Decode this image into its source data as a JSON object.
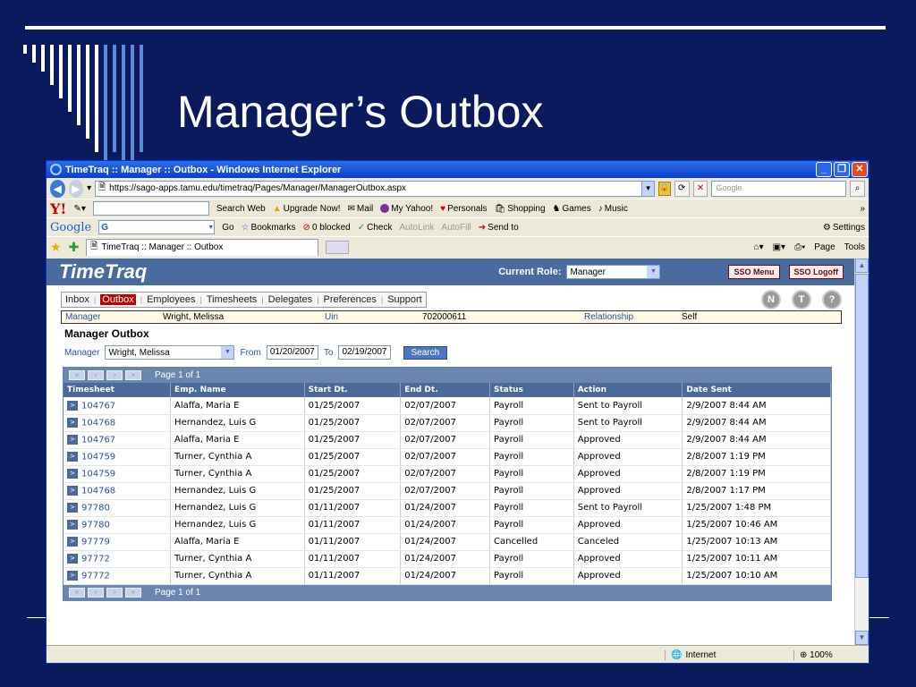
{
  "slide": {
    "title": "Manager’s Outbox"
  },
  "browser": {
    "window_title": "TimeTraq :: Manager :: Outbox - Windows Internet Explorer",
    "window_buttons": [
      "_",
      "❐",
      "✕"
    ],
    "address": "https://sago-apps.tamu.edu/timetraq/Pages/Manager/ManagerOutbox.aspx",
    "search_placeholder": "Google",
    "yahoo_toolbar": {
      "logo": "Y!",
      "search_button": "Search Web",
      "items": [
        "Upgrade Now!",
        "Mail",
        "My Yahoo!",
        "Personals",
        "Shopping",
        "Games",
        "Music"
      ]
    },
    "google_toolbar": {
      "logo": "Google",
      "g_label": "G",
      "go": "Go",
      "items": [
        "Bookmarks",
        "0 blocked",
        "Check",
        "AutoLink",
        "AutoFill",
        "Send to"
      ],
      "settings": "Settings"
    },
    "tab_title": "TimeTraq :: Manager :: Outbox",
    "tab_tools": [
      "Page",
      "Tools"
    ],
    "status": {
      "zone": "Internet",
      "zoom": "100%"
    }
  },
  "app": {
    "logo": "TimeTraq",
    "role_label": "Current Role:",
    "role_value": "Manager",
    "sso_menu": "SSO Menu",
    "sso_logoff": "SSO Logoff",
    "nav": [
      "Inbox",
      "Outbox",
      "Employees",
      "Timesheets",
      "Delegates",
      "Preferences",
      "Support"
    ],
    "nav_active_index": 1,
    "circle_buttons": [
      "N",
      "T",
      "?"
    ],
    "info": {
      "role": "Manager",
      "name": "Wright, Melissa",
      "uin_label": "Uin",
      "uin": "702000611",
      "relationship_label": "Relationship",
      "relationship": "Self"
    },
    "section_title": "Manager Outbox",
    "filter": {
      "manager_label": "Manager",
      "manager_value": "Wright, Melissa",
      "from_label": "From",
      "from_value": "01/20/2007",
      "to_label": "To",
      "to_value": "02/19/2007",
      "search_button": "Search"
    },
    "pager_text": "Page 1 of 1",
    "columns": [
      "Timesheet",
      "Emp. Name",
      "Start Dt.",
      "End Dt.",
      "Status",
      "Action",
      "Date Sent"
    ],
    "rows": [
      [
        "104767",
        "Alaffa, Maria E",
        "01/25/2007",
        "02/07/2007",
        "Payroll",
        "Sent to Payroll",
        "2/9/2007 8:44 AM"
      ],
      [
        "104768",
        "Hernandez, Luis G",
        "01/25/2007",
        "02/07/2007",
        "Payroll",
        "Sent to Payroll",
        "2/9/2007 8:44 AM"
      ],
      [
        "104767",
        "Alaffa, Maria E",
        "01/25/2007",
        "02/07/2007",
        "Payroll",
        "Approved",
        "2/9/2007 8:44 AM"
      ],
      [
        "104759",
        "Turner, Cynthia A",
        "01/25/2007",
        "02/07/2007",
        "Payroll",
        "Approved",
        "2/8/2007 1:19 PM"
      ],
      [
        "104759",
        "Turner, Cynthia A",
        "01/25/2007",
        "02/07/2007",
        "Payroll",
        "Approved",
        "2/8/2007 1:19 PM"
      ],
      [
        "104768",
        "Hernandez, Luis G",
        "01/25/2007",
        "02/07/2007",
        "Payroll",
        "Approved",
        "2/8/2007 1:17 PM"
      ],
      [
        "97780",
        "Hernandez, Luis G",
        "01/11/2007",
        "01/24/2007",
        "Payroll",
        "Sent to Payroll",
        "1/25/2007 1:48 PM"
      ],
      [
        "97780",
        "Hernandez, Luis G",
        "01/11/2007",
        "01/24/2007",
        "Payroll",
        "Approved",
        "1/25/2007 10:46 AM"
      ],
      [
        "97779",
        "Alaffa, Maria E",
        "01/11/2007",
        "01/24/2007",
        "Cancelled",
        "Canceled",
        "1/25/2007 10:13 AM"
      ],
      [
        "97772",
        "Turner, Cynthia A",
        "01/11/2007",
        "01/24/2007",
        "Payroll",
        "Approved",
        "1/25/2007 10:11 AM"
      ],
      [
        "97772",
        "Turner, Cynthia A",
        "01/11/2007",
        "01/24/2007",
        "Payroll",
        "Approved",
        "1/25/2007 10:10 AM"
      ]
    ]
  },
  "colors": {
    "slide_bg": "#0a1a5c",
    "header_blue": "#4a6b9e",
    "active_tab": "#c00000"
  }
}
